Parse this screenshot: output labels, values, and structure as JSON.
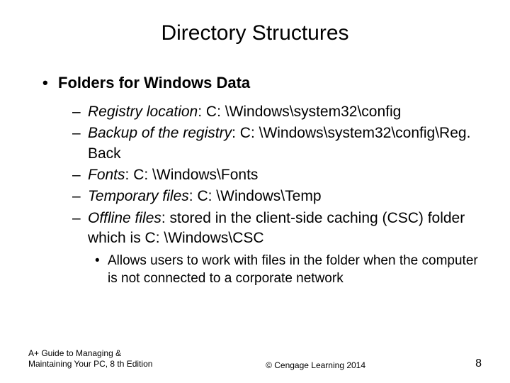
{
  "title": "Directory Structures",
  "mainBullet": "Folders for Windows Data",
  "items": [
    {
      "label": "Registry location",
      "value": ": C: \\Windows\\system32\\config"
    },
    {
      "label": "Backup of the registry",
      "value": ": C: \\Windows\\system32\\config\\Reg. Back"
    },
    {
      "label": "Fonts",
      "value": ": C: \\Windows\\Fonts"
    },
    {
      "label": "Temporary files",
      "value": ": C: \\Windows\\Temp"
    },
    {
      "label": "Offline files",
      "value": ": stored in the client-side caching (CSC) folder which is C: \\Windows\\CSC"
    }
  ],
  "subsub": "Allows users to work with files in the folder when the computer is not connected to a corporate network",
  "footer": {
    "left": "A+ Guide to Managing & Maintaining Your PC, 8 th Edition",
    "center": "© Cengage Learning  2014",
    "right": "8"
  }
}
